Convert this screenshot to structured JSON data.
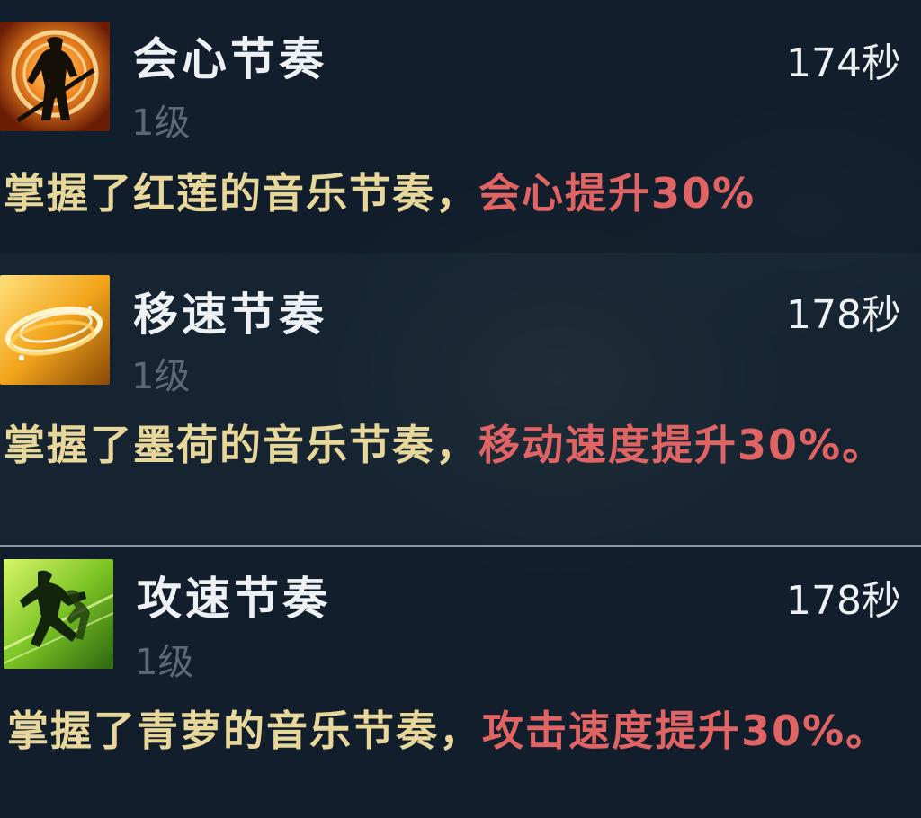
{
  "buffs": [
    {
      "name": "会心节奏",
      "level": "1级",
      "time": "174秒",
      "desc_prefix": "掌握了红莲的音乐节奏，",
      "desc_effect": "会心提升30%",
      "icon": "crit-rhythm-icon",
      "icon_colors": [
        "#f7a23a",
        "#c2470e"
      ]
    },
    {
      "name": "移速节奏",
      "level": "1级",
      "time": "178秒",
      "desc_prefix": "掌握了墨荷的音乐节奏，",
      "desc_effect": "移动速度提升30%。",
      "icon": "move-speed-rhythm-icon",
      "icon_colors": [
        "#ffd24a",
        "#c77a0c"
      ]
    },
    {
      "name": "攻速节奏",
      "level": "1级",
      "time": "178秒",
      "desc_prefix": "掌握了青萝的音乐节奏，",
      "desc_effect": "攻击速度提升30%。",
      "icon": "attack-speed-rhythm-icon",
      "icon_colors": [
        "#b9e84a",
        "#3f8a14"
      ]
    }
  ],
  "colors": {
    "desc_text": "#e8d79a",
    "effect_text": "#e06464",
    "level_text": "#5c6876",
    "title_text": "#eef1f4"
  }
}
